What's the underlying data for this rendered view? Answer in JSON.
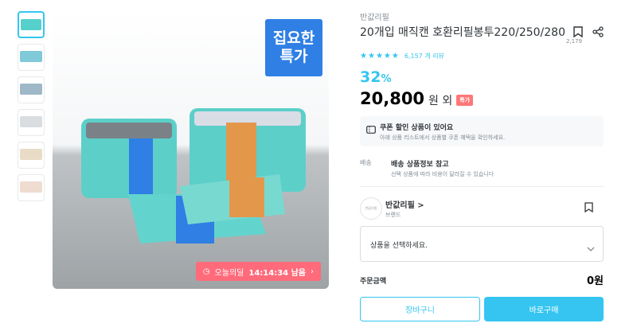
{
  "gallery": {
    "promo_badge": [
      "집요한",
      "특가"
    ],
    "timer": {
      "label": "오늘의딜",
      "time": "14:14:34 남음"
    },
    "thumb_colors": [
      "#56d0cc",
      "#7fc9d8",
      "#9fb8c8",
      "#d9dde0",
      "#e8dcc6",
      "#efdcd0"
    ]
  },
  "product": {
    "brand": "반값리필",
    "title": "20개입 매직캔 호환리필봉투220/250/280",
    "scrap_count": "2,179",
    "rating": 5,
    "review_text": "6,157 개 리뷰",
    "discount": "32",
    "discount_unit": "%",
    "price": "20,800",
    "price_suffix": "원 외",
    "price_tag": "특가"
  },
  "coupon": {
    "title": "쿠폰 할인 상품이 있어요",
    "sub": "아래 상품 리스트에서 상품별 쿠폰 혜택을 확인하세요."
  },
  "shipping": {
    "label": "배송",
    "title": "배송 상품정보 참고",
    "sub": "선택 상품에 따라 비용이 달라질 수 있습니다"
  },
  "brand_card": {
    "logo_text": "반값리필",
    "name": "반값리필 >",
    "sub": "브랜드"
  },
  "select": {
    "placeholder": "상품을 선택하세요."
  },
  "order": {
    "label": "주문금액",
    "value": "0원"
  },
  "buttons": {
    "cart": "장바구니",
    "buy": "바로구매"
  },
  "colors": {
    "accent": "#35c5f0",
    "sale_tag": "#ff7777",
    "timer_bg": "#ff6b7a",
    "badge_bg": "#2f7fe5"
  }
}
